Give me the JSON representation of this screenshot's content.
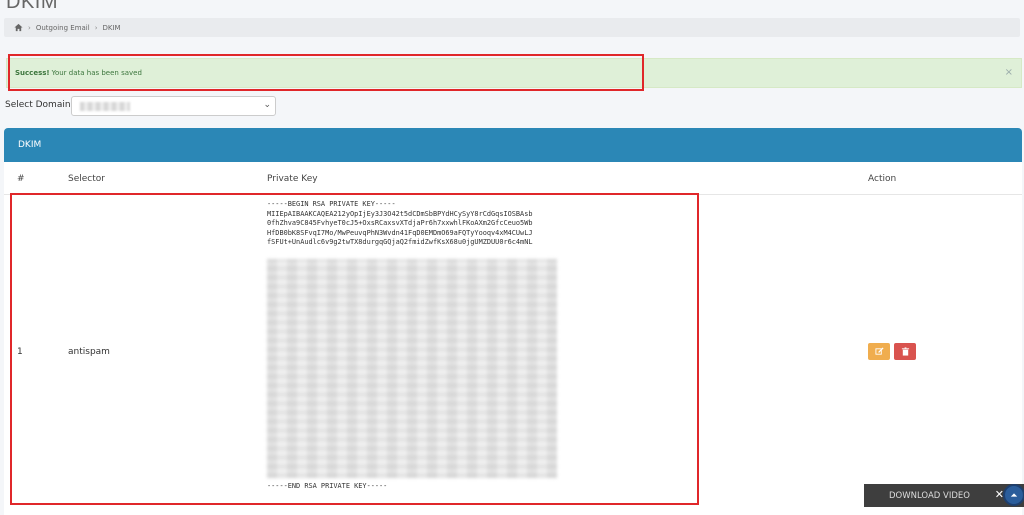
{
  "page": {
    "title": "DKIM"
  },
  "breadcrumb": {
    "items": [
      "Outgoing Email",
      "DKIM"
    ]
  },
  "alert": {
    "strong": "Success!",
    "message": "Your data has been saved",
    "close": "×"
  },
  "domain": {
    "label": "Select Domain",
    "chevron": "⌄"
  },
  "panel": {
    "title": "DKIM",
    "columns": [
      "#",
      "Selector",
      "Private Key",
      "Action"
    ],
    "row": {
      "num": "1",
      "selector": "antispam",
      "key_visible": "-----BEGIN RSA PRIVATE KEY-----\nMIIEpAIBAAKCAQEA212yOpIjEy3J3O42t5dCDmSbBPYdHCySyY8rCdGqsIOSBAsb\n0fhZhva9C845FvhyeT0cJ5+OxsRCaxsvXTdjaPr6h7xxwhlFKoAXm2GfcCeuo5Wb\nHfDB0bK8SFvqI7Mo/MwPeuvqPhN3Wvdn41FqD0EMDmO69aFQTyYooqv4xM4CUwLJ\nfSFUt+UnAudlc6v9g2twTX8durgqGQjaQ2fmidZwfKsX68u0jgUMZDUU0r6c4mNL",
      "key_end": "-----END RSA PRIVATE KEY-----"
    }
  },
  "download": {
    "label": "DOWNLOAD VIDEO",
    "close": "✕"
  },
  "colors": {
    "header": "#2b87b6",
    "alert_bg": "#dff0d8",
    "alert_text": "#3c763d",
    "highlight": "#e0272a",
    "edit": "#f0ad4e",
    "delete": "#d9534f"
  },
  "icons": [
    "home-icon",
    "edit-icon",
    "trash-icon",
    "chevron-down-icon",
    "arrow-up-icon"
  ]
}
